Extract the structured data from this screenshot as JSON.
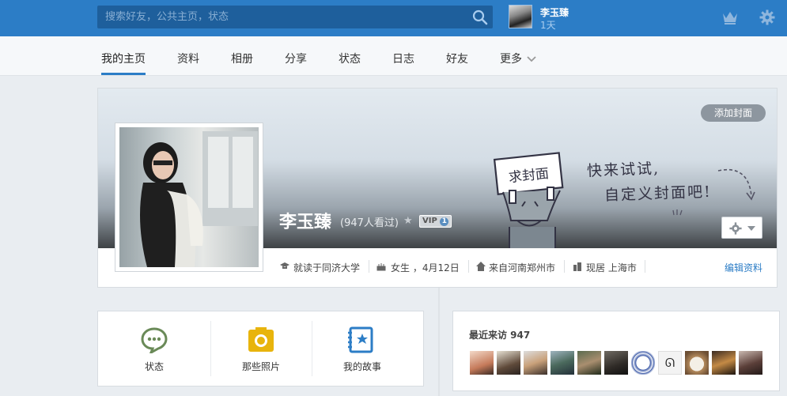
{
  "topbar": {
    "search_placeholder": "搜索好友，公共主页，状态",
    "user_name": "李玉臻",
    "user_days": "1天"
  },
  "nav": {
    "tabs": [
      "我的主页",
      "资料",
      "相册",
      "分享",
      "状态",
      "日志",
      "好友",
      "更多"
    ],
    "active_index": 0
  },
  "cover": {
    "add_cover_label": "添加封面",
    "sign_text": "求封面",
    "slogan_line1": "快来试试,",
    "slogan_line2": "自定义封面吧!"
  },
  "profile": {
    "name": "李玉臻",
    "views": "(947人看过)",
    "vip_label": "VIP",
    "vip_level": "1",
    "school": "就读于同济大学",
    "gender_birthday": "女生 ，4月12日",
    "hometown": "来自河南郑州市",
    "residence": "现居 上海市",
    "edit_label": "编辑资料"
  },
  "quick_actions": [
    {
      "label": "状态",
      "icon": "chat-bubble-icon",
      "color": "#6a8a58"
    },
    {
      "label": "那些照片",
      "icon": "camera-icon",
      "color": "#e8b40c"
    },
    {
      "label": "我的故事",
      "icon": "story-book-icon",
      "color": "#2c7dc6"
    }
  ],
  "visitors": {
    "title": "最近来访 947",
    "count": 11
  },
  "colors": {
    "brand_blue": "#2c7dc6",
    "topbar_bg": "#2c7dc6",
    "page_bg": "#e9edf1"
  }
}
